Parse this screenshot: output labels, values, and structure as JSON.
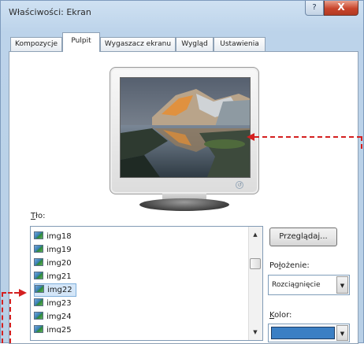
{
  "window": {
    "title": "Właściwości: Ekran",
    "help_label": "?",
    "close_label": "X"
  },
  "tabs": [
    {
      "label": "Kompozycje",
      "active": false
    },
    {
      "label": "Pulpit",
      "active": true
    },
    {
      "label": "Wygaszacz ekranu",
      "active": false
    },
    {
      "label": "Wygląd",
      "active": false
    },
    {
      "label": "Ustawienia",
      "active": false
    }
  ],
  "background": {
    "label_prefix": "T",
    "label_rest": "ło:",
    "items": [
      "img18",
      "img19",
      "img20",
      "img21",
      "img22",
      "img23",
      "img24",
      "img25"
    ],
    "selected": "img22"
  },
  "buttons": {
    "browse": "Przeglądaj..."
  },
  "position": {
    "label_prefix": "Po",
    "label_underline": "ł",
    "label_rest": "ożenie:",
    "value": "Rozciągnięcie"
  },
  "color": {
    "label_prefix": "K",
    "label_rest": "olor:",
    "value": "#3b7fc4"
  },
  "icons": {
    "scroll_up": "▲",
    "scroll_down": "▼",
    "dropdown": "▼",
    "power": "↺"
  },
  "colors": {
    "annotation": "#d42020",
    "accent": "#3b7fc4"
  }
}
